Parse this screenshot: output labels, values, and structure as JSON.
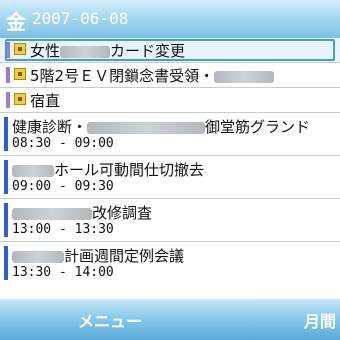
{
  "header": {
    "day": "金",
    "date": "2007-06-08"
  },
  "allday": [
    {
      "pre": "女性",
      "post": "カード変更"
    },
    {
      "pre": "5階2号ＥＶ閉鎖念書受領・",
      "post": ""
    },
    {
      "pre": "宿直",
      "post": ""
    }
  ],
  "events": [
    {
      "pre": "健康診断・",
      "post": "御堂筋グランド",
      "time": "08:30 - 09:00"
    },
    {
      "pre": "",
      "post": "ホール可動間仕切撤去",
      "time": "09:00 - 09:30"
    },
    {
      "pre": "",
      "post": "改修調査",
      "time": "13:00 - 13:30"
    },
    {
      "pre": "",
      "post": "計画週間定例会議",
      "time": "13:30 - 14:00"
    }
  ],
  "softkeys": {
    "left": "メニュー",
    "right": "月間"
  }
}
